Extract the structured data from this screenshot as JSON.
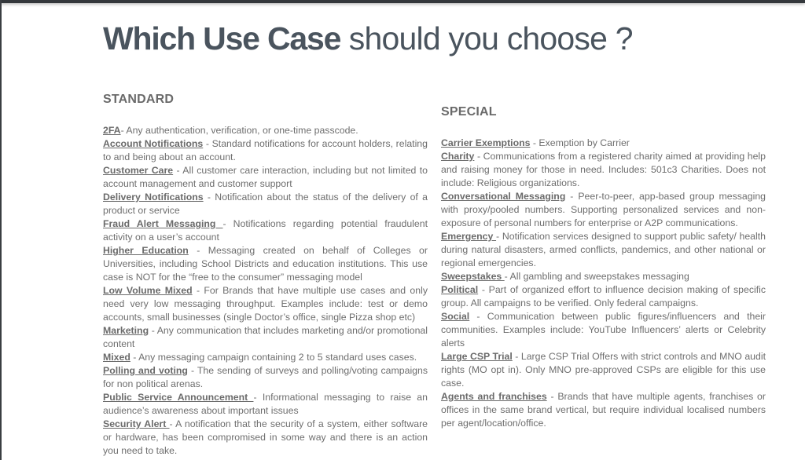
{
  "title": {
    "bold": "Which Use Case",
    "light": "should you choose ?"
  },
  "standard": {
    "heading": "STANDARD",
    "items": [
      {
        "term": "2FA",
        "desc": "- Any authentication, verification, or one-time passcode."
      },
      {
        "term": "Account Notifications",
        "desc": " - Standard notifications for account holders, relating to and being about an account."
      },
      {
        "term": "Customer Care",
        "desc": " - All customer care interaction, including but not limited to account management and customer support"
      },
      {
        "term": "Delivery Notifications",
        "desc": " - Notification about the status of the delivery of a product or service"
      },
      {
        "term": "Fraud Alert Messaging ",
        "desc": "- Notifications regarding potential fraudulent activity on a user’s account"
      },
      {
        "term": "Higher Education",
        "desc": " - Messaging created on behalf of Colleges or Universities, including School Districts and education institutions. This use case is NOT for the “free to the consumer” messaging model"
      },
      {
        "term": "Low Volume Mixed",
        "desc": " - For Brands that have multiple use cases and only need very low messaging throughput. Examples include: test or demo accounts, small businesses (single Doctor’s office, single Pizza shop etc)"
      },
      {
        "term": "Marketing",
        "desc": " - Any communication that includes marketing and/or promotional content"
      },
      {
        "term": "Mixed",
        "desc": " - Any messaging campaign containing 2 to 5 standard uses cases."
      },
      {
        "term": "Polling and voting",
        "desc": " - The sending of surveys and polling/voting campaigns for non political arenas."
      },
      {
        "term": "Public Service Announcement ",
        "desc": "- Informational messaging to raise an audience’s awareness about important issues"
      },
      {
        "term": "Security Alert ",
        "desc": "- A notification that the security of a system, either software or hardware, has been compromised in some way and there is an action you need to take."
      }
    ]
  },
  "special": {
    "heading": "SPECIAL",
    "items": [
      {
        "term": "Carrier Exemptions",
        "desc": " - Exemption by Carrier"
      },
      {
        "term": "Charity",
        "desc": " - Communications from a registered charity aimed at providing help and raising money for those in need. Includes: 501c3 Charities. Does not include: Religious organizations."
      },
      {
        "term": "Conversational Messaging",
        "desc": " - Peer-to-peer, app-based group messaging with proxy/pooled numbers. Supporting personalized services and non-exposure of personal numbers for enterprise or A2P communications."
      },
      {
        "term": "Emergency ",
        "desc": "- Notification services designed to support public safety/ health during natural disasters, armed conflicts, pandemics, and other national or regional emergencies."
      },
      {
        "term": "Sweepstakes ",
        "desc": "- All gambling and sweepstakes messaging"
      },
      {
        "term": "Political",
        "desc": " - Part of organized effort to influence decision making of specific group. All campaigns to be verified. Only federal campaigns."
      },
      {
        "term": "Social",
        "desc": " - Communication between public figures/influencers and their communities. Examples include: YouTube Influencers’ alerts or Celebrity alerts"
      },
      {
        "term": "Large CSP Trial",
        "desc": " - Large CSP Trial Offers with strict controls and MNO audit rights (MO opt in). Only MNO pre-approved CSPs are eligible for this use case."
      },
      {
        "term": "Agents and franchises",
        "desc": " - Brands that have multiple agents, franchises or offices in the same brand vertical, but require individual localised numbers per agent/location/office."
      }
    ]
  }
}
